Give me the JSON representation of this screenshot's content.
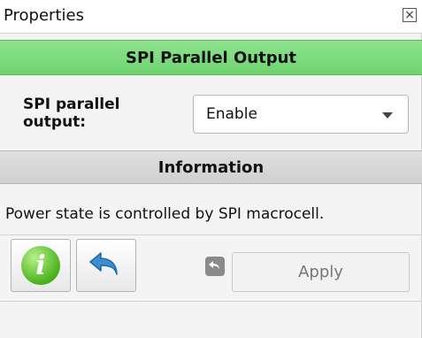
{
  "window": {
    "title": "Properties",
    "close_icon": "close-box-icon"
  },
  "section": {
    "title": "SPI Parallel Output",
    "color": "#7ddc7d"
  },
  "property": {
    "label": "SPI parallel output:",
    "selected": "Enable"
  },
  "information": {
    "header": "Information",
    "text": "Power state is controlled by SPI macrocell."
  },
  "toolbar": {
    "info_icon": "info-circle-icon",
    "info_glyph": "i",
    "undo_icon": "undo-arrow-icon",
    "revert_icon": "revert-small-icon",
    "apply_label": "Apply",
    "accent_blue": "#3b8fd0",
    "accent_green": "#49b21a"
  }
}
